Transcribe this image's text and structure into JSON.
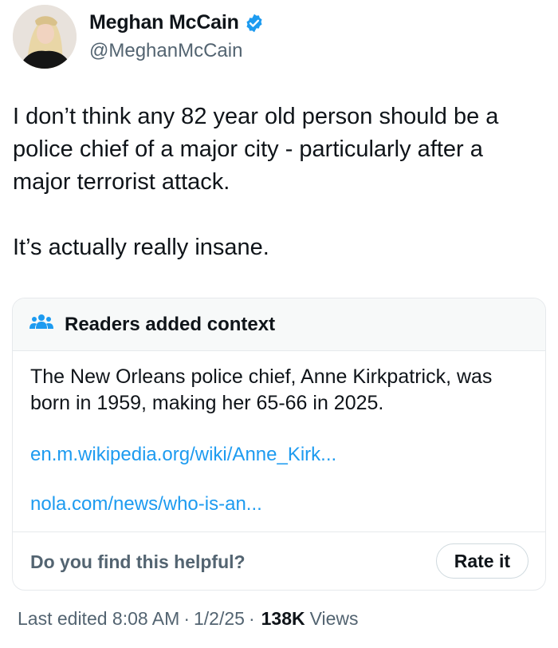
{
  "author": {
    "name": "Meghan McCain",
    "handle": "@MeghanMcCain",
    "verified": true,
    "avatar_icon": "profile-photo"
  },
  "tweet": {
    "text": "I don’t think any 82 year old person should be a police chief of a major city - particularly after a major terrorist attack.\n\nIt’s actually really insane."
  },
  "community_note": {
    "icon": "people-group-icon",
    "title": "Readers added context",
    "body": "The New Orleans police chief, Anne Kirkpatrick, was born in 1959, making her 65-66 in 2025.",
    "links": [
      "en.m.wikipedia.org/wiki/Anne_Kirk...",
      "nola.com/news/who-is-an..."
    ],
    "helpful_prompt": "Do you find this helpful?",
    "rate_label": "Rate it"
  },
  "meta": {
    "edited_label": "Last edited 8:08 AM",
    "date": "1/2/25",
    "views_count": "138K",
    "views_label": "Views"
  },
  "colors": {
    "text_primary": "#0f1419",
    "text_secondary": "#536471",
    "link": "#1d9bf0",
    "verified": "#1d9bf0",
    "note_header_bg": "#f7f9f9",
    "border": "#e6e9ec"
  }
}
